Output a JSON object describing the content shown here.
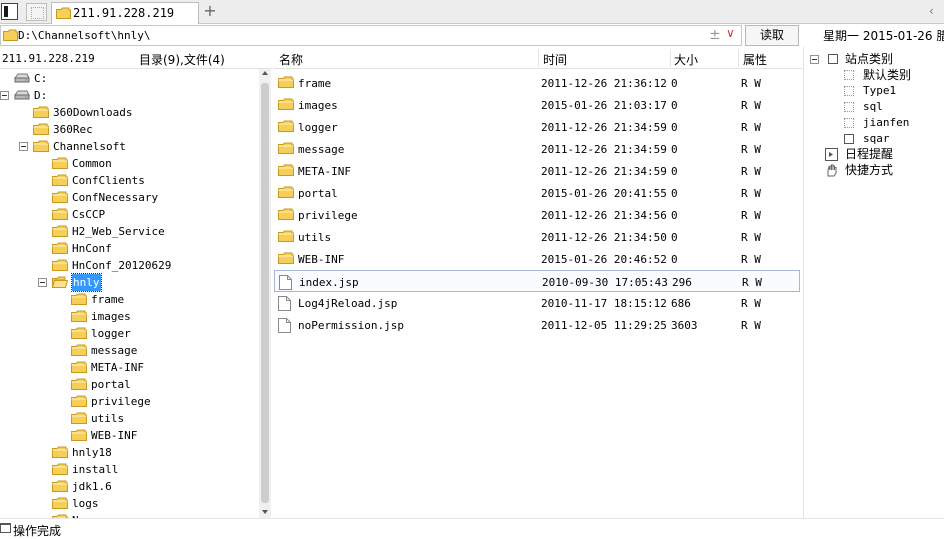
{
  "tabbar": {
    "active_tab": "211.91.228.219",
    "add_symbol": "+"
  },
  "address": {
    "path": "D:\\Channelsoft\\hnly\\",
    "plus_symbol": "±",
    "dropdown_symbol": "∨",
    "read_button": "读取"
  },
  "datetime": "星期一  2015-01-26  腊",
  "left_panel": {
    "host": "211.91.228.219",
    "dir_count": "目录(9),文件(4)",
    "tree": [
      {
        "label": "C:",
        "type": "drive"
      },
      {
        "label": "D:",
        "type": "drive"
      },
      {
        "label": "360Downloads",
        "type": "folder"
      },
      {
        "label": "360Rec",
        "type": "folder"
      },
      {
        "label": "Channelsoft",
        "type": "folder"
      },
      {
        "label": "Common",
        "type": "folder"
      },
      {
        "label": "ConfClients",
        "type": "folder"
      },
      {
        "label": "ConfNecessary",
        "type": "folder"
      },
      {
        "label": "CsCCP",
        "type": "folder"
      },
      {
        "label": "H2_Web_Service",
        "type": "folder"
      },
      {
        "label": "HnConf",
        "type": "folder"
      },
      {
        "label": "HnConf_20120629",
        "type": "folder"
      },
      {
        "label": "hnly",
        "type": "folder-open"
      },
      {
        "label": "frame",
        "type": "folder"
      },
      {
        "label": "images",
        "type": "folder"
      },
      {
        "label": "logger",
        "type": "folder"
      },
      {
        "label": "message",
        "type": "folder"
      },
      {
        "label": "META-INF",
        "type": "folder"
      },
      {
        "label": "portal",
        "type": "folder"
      },
      {
        "label": "privilege",
        "type": "folder"
      },
      {
        "label": "utils",
        "type": "folder"
      },
      {
        "label": "WEB-INF",
        "type": "folder"
      },
      {
        "label": "hnly18",
        "type": "folder"
      },
      {
        "label": "install",
        "type": "folder"
      },
      {
        "label": "jdk1.6",
        "type": "folder"
      },
      {
        "label": "logs",
        "type": "folder"
      },
      {
        "label": "N",
        "type": "folder"
      }
    ]
  },
  "file_list": {
    "columns": [
      "名称",
      "时间",
      "大小",
      "属性"
    ],
    "rows": [
      {
        "name": "frame",
        "type": "folder",
        "time": "2011-12-26 21:36:12",
        "size": "0",
        "attr": "R W"
      },
      {
        "name": "images",
        "type": "folder",
        "time": "2015-01-26 21:03:17",
        "size": "0",
        "attr": "R W"
      },
      {
        "name": "logger",
        "type": "folder",
        "time": "2011-12-26 21:34:59",
        "size": "0",
        "attr": "R W"
      },
      {
        "name": "message",
        "type": "folder",
        "time": "2011-12-26 21:34:59",
        "size": "0",
        "attr": "R W"
      },
      {
        "name": "META-INF",
        "type": "folder",
        "time": "2011-12-26 21:34:59",
        "size": "0",
        "attr": "R W"
      },
      {
        "name": "portal",
        "type": "folder",
        "time": "2015-01-26 20:41:55",
        "size": "0",
        "attr": "R W"
      },
      {
        "name": "privilege",
        "type": "folder",
        "time": "2011-12-26 21:34:56",
        "size": "0",
        "attr": "R W"
      },
      {
        "name": "utils",
        "type": "folder",
        "time": "2011-12-26 21:34:50",
        "size": "0",
        "attr": "R W"
      },
      {
        "name": "WEB-INF",
        "type": "folder",
        "time": "2015-01-26 20:46:52",
        "size": "0",
        "attr": "R W"
      },
      {
        "name": "index.jsp",
        "type": "file",
        "time": "2010-09-30 17:05:43",
        "size": "296",
        "attr": "R W"
      },
      {
        "name": "Log4jReload.jsp",
        "type": "file",
        "time": "2010-11-17 18:15:12",
        "size": "686",
        "attr": "R W"
      },
      {
        "name": "noPermission.jsp",
        "type": "file",
        "time": "2011-12-05 11:29:25",
        "size": "3603",
        "attr": "R W"
      }
    ]
  },
  "right_panel": {
    "site_category": "站点类别",
    "default_category": "默认类别",
    "categories": [
      "Type1",
      "sql",
      "jianfen",
      "sqar"
    ],
    "reminder": "日程提醒",
    "shortcuts": "快捷方式"
  },
  "status": "操作完成",
  "colors": {
    "folder_fill": "#f5cf5a",
    "folder_edge": "#c99a1e",
    "selection": "#3399ff"
  }
}
